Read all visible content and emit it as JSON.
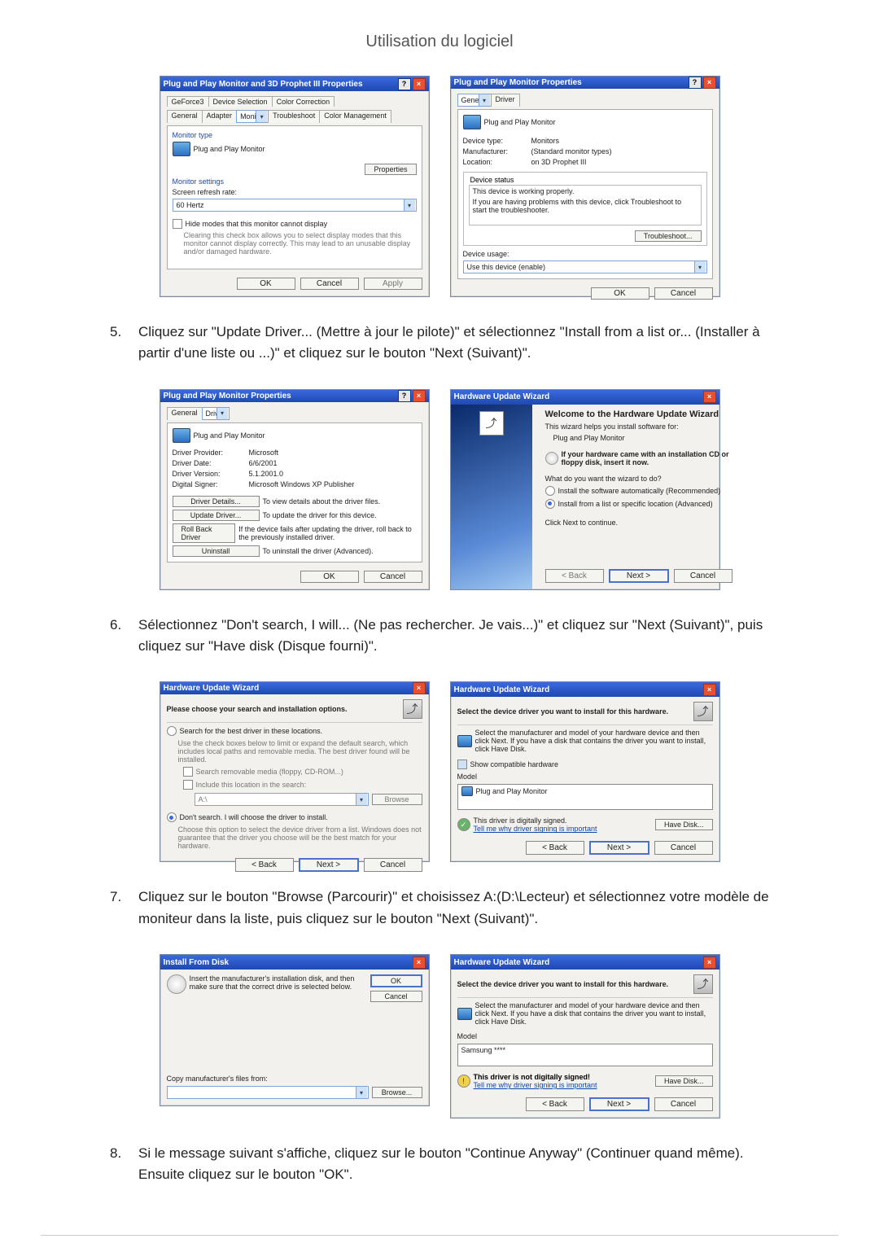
{
  "page": {
    "title": "Utilisation du logiciel"
  },
  "steps": {
    "s5": {
      "num": "5.",
      "text": "Cliquez sur \"Update Driver... (Mettre à jour le pilote)\" et sélectionnez \"Install from a list or... (Installer à partir d'une liste ou ...)\" et cliquez sur le bouton \"Next (Suivant)\"."
    },
    "s6": {
      "num": "6.",
      "text": "Sélectionnez \"Don't search, I will... (Ne pas rechercher. Je vais...)\" et cliquez sur \"Next (Suivant)\", puis cliquez sur \"Have disk (Disque fourni)\"."
    },
    "s7": {
      "num": "7.",
      "text": "Cliquez sur le bouton \"Browse (Parcourir)\" et choisissez A:(D:\\Lecteur) et sélectionnez votre modèle de moniteur dans la liste, puis cliquez sur le bouton \"Next (Suivant)\"."
    },
    "s8": {
      "num": "8.",
      "text": "Si le message suivant s'affiche, cliquez sur le bouton \"Continue Anyway\" (Continuer quand même). Ensuite cliquez sur le bouton \"OK\"."
    }
  },
  "dlg1a": {
    "title": "Plug and Play Monitor and 3D Prophet III Properties",
    "tabs": [
      "GeForce3",
      "Device Selection",
      "Color Correction",
      "General",
      "Adapter",
      "Monitor",
      "Troubleshoot",
      "Color Management"
    ],
    "group1": "Monitor type",
    "monitor": "Plug and Play Monitor",
    "props": "Properties",
    "group2": "Monitor settings",
    "refresh_lbl": "Screen refresh rate:",
    "refresh_val": "60 Hertz",
    "hide": "Hide modes that this monitor cannot display",
    "hide_note": "Clearing this check box allows you to select display modes that this monitor cannot display correctly. This may lead to an unusable display and/or damaged hardware.",
    "ok": "OK",
    "cancel": "Cancel",
    "apply": "Apply"
  },
  "dlg1b": {
    "title": "Plug and Play Monitor Properties",
    "tabs": [
      "General",
      "Driver"
    ],
    "monitor": "Plug and Play Monitor",
    "dtype_l": "Device type:",
    "dtype_v": "Monitors",
    "manu_l": "Manufacturer:",
    "manu_v": "(Standard monitor types)",
    "loc_l": "Location:",
    "loc_v": "on 3D Prophet III",
    "status_leg": "Device status",
    "status1": "This device is working properly.",
    "status2": "If you are having problems with this device, click Troubleshoot to start the troubleshooter.",
    "trouble": "Troubleshoot...",
    "usage_l": "Device usage:",
    "usage_v": "Use this device (enable)",
    "ok": "OK",
    "cancel": "Cancel"
  },
  "dlg2a": {
    "title": "Plug and Play Monitor Properties",
    "tabs": [
      "General",
      "Driver"
    ],
    "monitor": "Plug and Play Monitor",
    "prov_l": "Driver Provider:",
    "prov_v": "Microsoft",
    "date_l": "Driver Date:",
    "date_v": "6/6/2001",
    "ver_l": "Driver Version:",
    "ver_v": "5.1.2001.0",
    "sig_l": "Digital Signer:",
    "sig_v": "Microsoft Windows XP Publisher",
    "b_det": "Driver Details...",
    "b_det_t": "To view details about the driver files.",
    "b_upd": "Update Driver...",
    "b_upd_t": "To update the driver for this device.",
    "b_rb": "Roll Back Driver",
    "b_rb_t": "If the device fails after updating the driver, roll back to the previously installed driver.",
    "b_un": "Uninstall",
    "b_un_t": "To uninstall the driver (Advanced).",
    "ok": "OK",
    "cancel": "Cancel"
  },
  "dlg2b": {
    "title": "Hardware Update Wizard",
    "h1": "Welcome to the Hardware Update Wizard",
    "p1": "This wizard helps you install software for:",
    "p2": "Plug and Play Monitor",
    "cd": "If your hardware came with an installation CD or floppy disk, insert it now.",
    "q": "What do you want the wizard to do?",
    "o1": "Install the software automatically (Recommended)",
    "o2": "Install from a list or specific location (Advanced)",
    "cont": "Click Next to continue.",
    "back": "< Back",
    "next": "Next >",
    "cancel": "Cancel"
  },
  "dlg3a": {
    "title": "Hardware Update Wizard",
    "h": "Please choose your search and installation options.",
    "o1": "Search for the best driver in these locations.",
    "o1t": "Use the check boxes below to limit or expand the default search, which includes local paths and removable media. The best driver found will be installed.",
    "c1": "Search removable media (floppy, CD-ROM...)",
    "c2": "Include this location in the search:",
    "path": "A:\\",
    "browse": "Browse",
    "o2": "Don't search. I will choose the driver to install.",
    "o2t": "Choose this option to select the device driver from a list. Windows does not guarantee that the driver you choose will be the best match for your hardware.",
    "back": "< Back",
    "next": "Next >",
    "cancel": "Cancel"
  },
  "dlg3b": {
    "title": "Hardware Update Wizard",
    "h": "Select the device driver you want to install for this hardware.",
    "p": "Select the manufacturer and model of your hardware device and then click Next. If you have a disk that contains the driver you want to install, click Have Disk.",
    "compat": "Show compatible hardware",
    "model_l": "Model",
    "model_v": "Plug and Play Monitor",
    "signed": "This driver is digitally signed.",
    "tell": "Tell me why driver signing is important",
    "have": "Have Disk...",
    "back": "< Back",
    "next": "Next >",
    "cancel": "Cancel"
  },
  "dlg4a": {
    "title": "Install From Disk",
    "msg": "Insert the manufacturer's installation disk, and then make sure that the correct drive is selected below.",
    "ok": "OK",
    "cancel": "Cancel",
    "copy_l": "Copy manufacturer's files from:",
    "path": "",
    "browse": "Browse..."
  },
  "dlg4b": {
    "title": "Hardware Update Wizard",
    "h": "Select the device driver you want to install for this hardware.",
    "p": "Select the manufacturer and model of your hardware device and then click Next. If you have a disk that contains the driver you want to install, click Have Disk.",
    "model_l": "Model",
    "model_v": "Samsung ****",
    "nsigned": "This driver is not digitally signed!",
    "tell": "Tell me why driver signing is important",
    "have": "Have Disk...",
    "back": "< Back",
    "next": "Next >",
    "cancel": "Cancel"
  }
}
